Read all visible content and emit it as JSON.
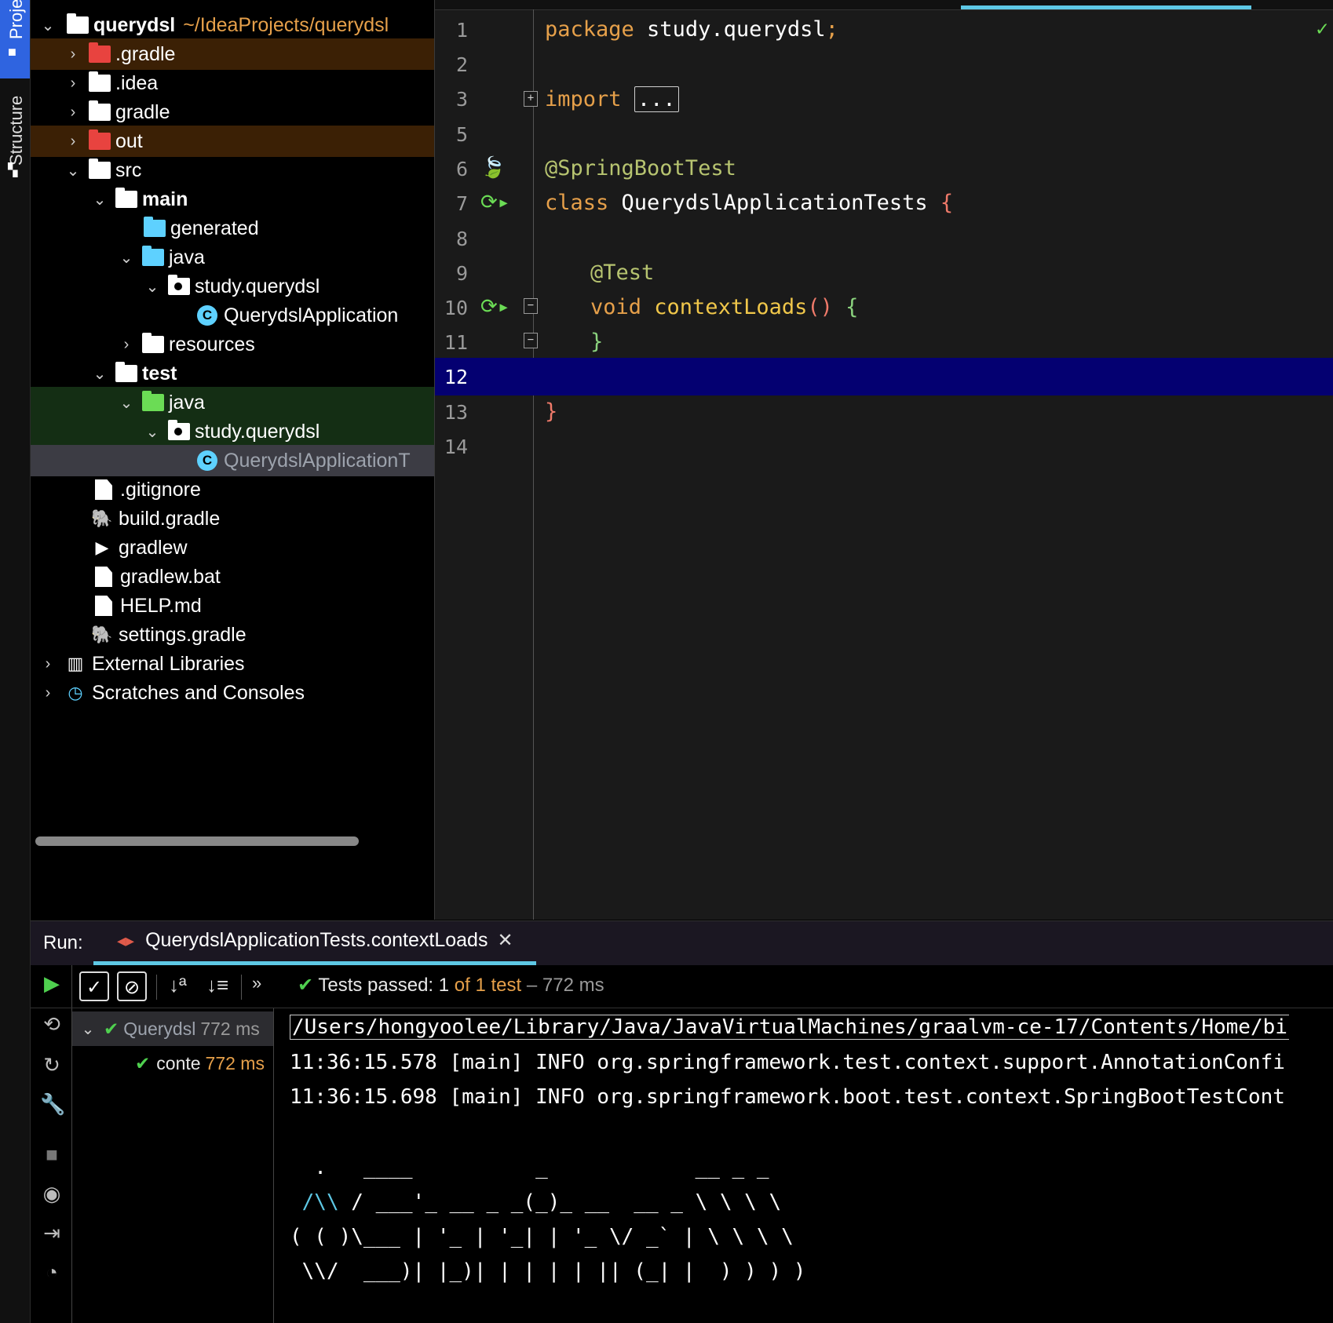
{
  "toolstrip": {
    "project_label": "Proje",
    "structure_label": "Structure"
  },
  "project_tree": {
    "root": {
      "name": "querydsl",
      "path": "~/IdeaProjects/querydsl"
    },
    "items": [
      {
        "label": ".gradle"
      },
      {
        "label": ".idea"
      },
      {
        "label": "gradle"
      },
      {
        "label": "out"
      },
      {
        "label": "src"
      },
      {
        "label": "main"
      },
      {
        "label": "generated"
      },
      {
        "label": "java"
      },
      {
        "label": "study.querydsl"
      },
      {
        "label": "QuerydslApplication"
      },
      {
        "label": "resources"
      },
      {
        "label": "test"
      },
      {
        "label": "java"
      },
      {
        "label": "study.querydsl"
      },
      {
        "label": "QuerydslApplicationT"
      },
      {
        "label": ".gitignore"
      },
      {
        "label": "build.gradle"
      },
      {
        "label": "gradlew"
      },
      {
        "label": "gradlew.bat"
      },
      {
        "label": "HELP.md"
      },
      {
        "label": "settings.gradle"
      },
      {
        "label": "External Libraries"
      },
      {
        "label": "Scratches and Consoles"
      }
    ]
  },
  "editor": {
    "line_numbers": [
      "1",
      "2",
      "3",
      "5",
      "6",
      "7",
      "8",
      "9",
      "10",
      "11",
      "12",
      "13",
      "14"
    ],
    "current_line": "12",
    "code": {
      "l1_kw": "package",
      "l1_rest": " study.querydsl",
      "l1_semi": ";",
      "l3_kw": "import",
      "l3_fold": "...",
      "l6_ann": "@SpringBootTest",
      "l7_kw": "class",
      "l7_name": " QuerydslApplicationTests ",
      "l7_brace": "{",
      "l9_ann": "@Test",
      "l10_kw": "void",
      "l10_fn": " contextLoads",
      "l10_paren": "()",
      "l10_brace": " {",
      "l11_brace": "}",
      "l13_brace": "}"
    }
  },
  "run_panel": {
    "label": "Run:",
    "tab_title": "QuerydslApplicationTests.contextLoads",
    "status": {
      "prefix": "Tests passed: ",
      "passed": "1",
      "of_text": " of 1 test",
      "duration": " – 772 ms"
    },
    "test_tree": [
      {
        "name": "Querydsl",
        "time": "772 ms"
      },
      {
        "name": "conte",
        "time": "772 ms"
      }
    ],
    "console_lines": [
      "/Users/hongyoolee/Library/Java/JavaVirtualMachines/graalvm-ce-17/Contents/Home/bi",
      "11:36:15.578 [main] INFO org.springframework.test.context.support.AnnotationConfi",
      "11:36:15.698 [main] INFO org.springframework.boot.test.context.SpringBootTestCont"
    ],
    "banner": {
      "l1": "  .   ____          _            __ _ _",
      "l2_blue": " /\\\\",
      "l2_rest": " / ___'_ __ _ _(_)_ __  __ _ \\ \\ \\ \\",
      "l3": "( ( )\\___ | '_ | '_| | '_ \\/ _` | \\ \\ \\ \\",
      "l4": " \\\\/  ___)| |_)| | | | | || (_| |  ) ) ) )"
    }
  },
  "colors": {
    "accent": "#2f64e0",
    "current_line": "#040071",
    "tab_underline": "#5ec8e5",
    "pass_green": "#4fd04f",
    "keyword": "#e6a04a"
  }
}
